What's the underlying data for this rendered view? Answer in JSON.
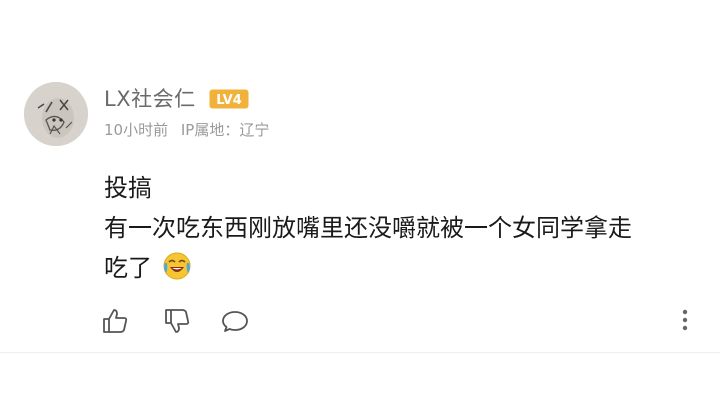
{
  "comment": {
    "username": "LX社会仁",
    "level_badge": "LV4",
    "time": "10小时前",
    "ip_location": "IP属地：辽宁",
    "content_lines": [
      "投搞",
      "有一次吃东西刚放嘴里还没嚼就被一个女同学拿走",
      "吃了"
    ],
    "emoji": "laughing-crying-emoji",
    "colors": {
      "badge": "#f0b23a",
      "username": "#6a6a6a",
      "meta": "#9a9a9a",
      "text": "#1a1a1a",
      "icon": "#555555"
    }
  },
  "actions": {
    "like_icon": "thumbs-up-icon",
    "dislike_icon": "thumbs-down-icon",
    "reply_icon": "comment-bubble-icon",
    "more_icon": "vertical-dots-icon"
  }
}
